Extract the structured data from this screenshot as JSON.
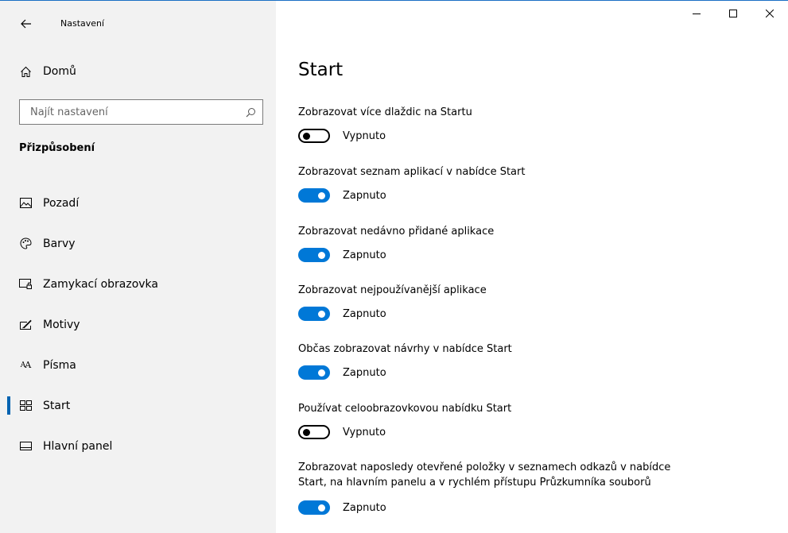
{
  "window": {
    "app_title": "Nastavení",
    "controls": {
      "minimize": "—",
      "maximize": "☐",
      "close": "✕"
    }
  },
  "sidebar": {
    "home_label": "Domů",
    "search_placeholder": "Najít nastavení",
    "section_heading": "Přizpůsobení",
    "items": [
      {
        "label": "Pozadí",
        "icon": "picture-icon"
      },
      {
        "label": "Barvy",
        "icon": "palette-icon"
      },
      {
        "label": "Zamykací obrazovka",
        "icon": "lock-screen-icon"
      },
      {
        "label": "Motivy",
        "icon": "themes-icon"
      },
      {
        "label": "Písma",
        "icon": "fonts-icon"
      },
      {
        "label": "Start",
        "icon": "start-icon",
        "selected": true
      },
      {
        "label": "Hlavní panel",
        "icon": "taskbar-icon"
      }
    ]
  },
  "main": {
    "page_title": "Start",
    "settings": [
      {
        "label": "Zobrazovat více dlaždic na Startu",
        "on": false,
        "state": "Vypnuto"
      },
      {
        "label": "Zobrazovat seznam aplikací v nabídce Start",
        "on": true,
        "state": "Zapnuto"
      },
      {
        "label": "Zobrazovat nedávno přidané aplikace",
        "on": true,
        "state": "Zapnuto"
      },
      {
        "label": "Zobrazovat nejpoužívanější aplikace",
        "on": true,
        "state": "Zapnuto"
      },
      {
        "label": "Občas zobrazovat návrhy v nabídce Start",
        "on": true,
        "state": "Zapnuto"
      },
      {
        "label": "Používat celoobrazovkovou nabídku Start",
        "on": false,
        "state": "Vypnuto"
      },
      {
        "label": "Zobrazovat naposledy otevřené položky v seznamech odkazů v nabídce Start, na hlavním panelu a v rychlém přístupu Průzkumníka souborů",
        "on": true,
        "state": "Zapnuto"
      }
    ]
  },
  "colors": {
    "accent": "#0078d7",
    "sidebar_bg": "#f2f2f2",
    "selection_bar": "#0063b1"
  }
}
